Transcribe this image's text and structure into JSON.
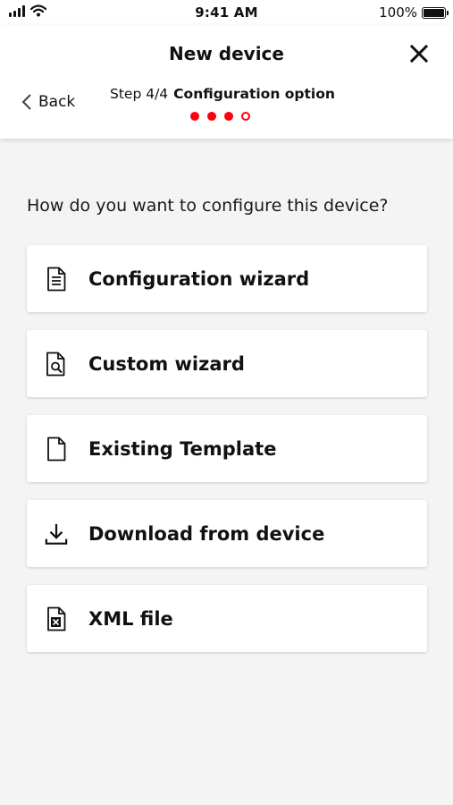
{
  "status_bar": {
    "time": "9:41 AM",
    "battery": "100%"
  },
  "header": {
    "title": "New device",
    "back_label": "Back",
    "step_count": "Step 4/4",
    "step_name": "Configuration option",
    "steps_total": 4,
    "steps_completed": 3
  },
  "content": {
    "question": "How do you want to configure this device?",
    "options": [
      {
        "label": "Configuration wizard",
        "icon": "document-icon"
      },
      {
        "label": "Custom wizard",
        "icon": "document-search-icon"
      },
      {
        "label": "Existing Template",
        "icon": "blank-document-icon"
      },
      {
        "label": "Download from device",
        "icon": "download-icon"
      },
      {
        "label": "XML file",
        "icon": "xml-file-icon"
      }
    ]
  },
  "colors": {
    "accent": "#ff000f",
    "background": "#f4f4f4",
    "card": "#ffffff"
  }
}
